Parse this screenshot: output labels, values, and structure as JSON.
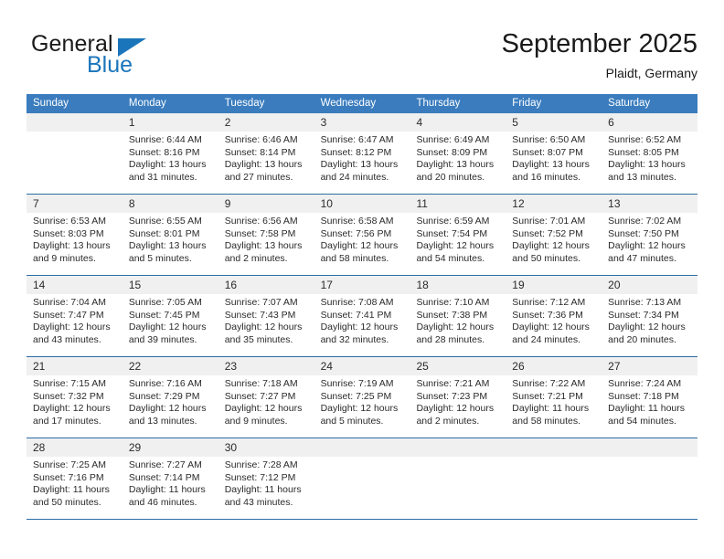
{
  "brand": {
    "name_part1": "General",
    "name_part2": "Blue",
    "accent_color": "#1b75bb"
  },
  "header": {
    "title": "September 2025",
    "subtitle": "Plaidt, Germany"
  },
  "calendar": {
    "header_color": "#3a7cbe",
    "separator_color": "#2b6ca8",
    "daynum_band_color": "#f0f0f0",
    "weekdays": [
      "Sunday",
      "Monday",
      "Tuesday",
      "Wednesday",
      "Thursday",
      "Friday",
      "Saturday"
    ],
    "weeks": [
      [
        {
          "day": "",
          "sunrise": "",
          "sunset": "",
          "daylight_line1": "",
          "daylight_line2": ""
        },
        {
          "day": "1",
          "sunrise": "Sunrise: 6:44 AM",
          "sunset": "Sunset: 8:16 PM",
          "daylight_line1": "Daylight: 13 hours",
          "daylight_line2": "and 31 minutes."
        },
        {
          "day": "2",
          "sunrise": "Sunrise: 6:46 AM",
          "sunset": "Sunset: 8:14 PM",
          "daylight_line1": "Daylight: 13 hours",
          "daylight_line2": "and 27 minutes."
        },
        {
          "day": "3",
          "sunrise": "Sunrise: 6:47 AM",
          "sunset": "Sunset: 8:12 PM",
          "daylight_line1": "Daylight: 13 hours",
          "daylight_line2": "and 24 minutes."
        },
        {
          "day": "4",
          "sunrise": "Sunrise: 6:49 AM",
          "sunset": "Sunset: 8:09 PM",
          "daylight_line1": "Daylight: 13 hours",
          "daylight_line2": "and 20 minutes."
        },
        {
          "day": "5",
          "sunrise": "Sunrise: 6:50 AM",
          "sunset": "Sunset: 8:07 PM",
          "daylight_line1": "Daylight: 13 hours",
          "daylight_line2": "and 16 minutes."
        },
        {
          "day": "6",
          "sunrise": "Sunrise: 6:52 AM",
          "sunset": "Sunset: 8:05 PM",
          "daylight_line1": "Daylight: 13 hours",
          "daylight_line2": "and 13 minutes."
        }
      ],
      [
        {
          "day": "7",
          "sunrise": "Sunrise: 6:53 AM",
          "sunset": "Sunset: 8:03 PM",
          "daylight_line1": "Daylight: 13 hours",
          "daylight_line2": "and 9 minutes."
        },
        {
          "day": "8",
          "sunrise": "Sunrise: 6:55 AM",
          "sunset": "Sunset: 8:01 PM",
          "daylight_line1": "Daylight: 13 hours",
          "daylight_line2": "and 5 minutes."
        },
        {
          "day": "9",
          "sunrise": "Sunrise: 6:56 AM",
          "sunset": "Sunset: 7:58 PM",
          "daylight_line1": "Daylight: 13 hours",
          "daylight_line2": "and 2 minutes."
        },
        {
          "day": "10",
          "sunrise": "Sunrise: 6:58 AM",
          "sunset": "Sunset: 7:56 PM",
          "daylight_line1": "Daylight: 12 hours",
          "daylight_line2": "and 58 minutes."
        },
        {
          "day": "11",
          "sunrise": "Sunrise: 6:59 AM",
          "sunset": "Sunset: 7:54 PM",
          "daylight_line1": "Daylight: 12 hours",
          "daylight_line2": "and 54 minutes."
        },
        {
          "day": "12",
          "sunrise": "Sunrise: 7:01 AM",
          "sunset": "Sunset: 7:52 PM",
          "daylight_line1": "Daylight: 12 hours",
          "daylight_line2": "and 50 minutes."
        },
        {
          "day": "13",
          "sunrise": "Sunrise: 7:02 AM",
          "sunset": "Sunset: 7:50 PM",
          "daylight_line1": "Daylight: 12 hours",
          "daylight_line2": "and 47 minutes."
        }
      ],
      [
        {
          "day": "14",
          "sunrise": "Sunrise: 7:04 AM",
          "sunset": "Sunset: 7:47 PM",
          "daylight_line1": "Daylight: 12 hours",
          "daylight_line2": "and 43 minutes."
        },
        {
          "day": "15",
          "sunrise": "Sunrise: 7:05 AM",
          "sunset": "Sunset: 7:45 PM",
          "daylight_line1": "Daylight: 12 hours",
          "daylight_line2": "and 39 minutes."
        },
        {
          "day": "16",
          "sunrise": "Sunrise: 7:07 AM",
          "sunset": "Sunset: 7:43 PM",
          "daylight_line1": "Daylight: 12 hours",
          "daylight_line2": "and 35 minutes."
        },
        {
          "day": "17",
          "sunrise": "Sunrise: 7:08 AM",
          "sunset": "Sunset: 7:41 PM",
          "daylight_line1": "Daylight: 12 hours",
          "daylight_line2": "and 32 minutes."
        },
        {
          "day": "18",
          "sunrise": "Sunrise: 7:10 AM",
          "sunset": "Sunset: 7:38 PM",
          "daylight_line1": "Daylight: 12 hours",
          "daylight_line2": "and 28 minutes."
        },
        {
          "day": "19",
          "sunrise": "Sunrise: 7:12 AM",
          "sunset": "Sunset: 7:36 PM",
          "daylight_line1": "Daylight: 12 hours",
          "daylight_line2": "and 24 minutes."
        },
        {
          "day": "20",
          "sunrise": "Sunrise: 7:13 AM",
          "sunset": "Sunset: 7:34 PM",
          "daylight_line1": "Daylight: 12 hours",
          "daylight_line2": "and 20 minutes."
        }
      ],
      [
        {
          "day": "21",
          "sunrise": "Sunrise: 7:15 AM",
          "sunset": "Sunset: 7:32 PM",
          "daylight_line1": "Daylight: 12 hours",
          "daylight_line2": "and 17 minutes."
        },
        {
          "day": "22",
          "sunrise": "Sunrise: 7:16 AM",
          "sunset": "Sunset: 7:29 PM",
          "daylight_line1": "Daylight: 12 hours",
          "daylight_line2": "and 13 minutes."
        },
        {
          "day": "23",
          "sunrise": "Sunrise: 7:18 AM",
          "sunset": "Sunset: 7:27 PM",
          "daylight_line1": "Daylight: 12 hours",
          "daylight_line2": "and 9 minutes."
        },
        {
          "day": "24",
          "sunrise": "Sunrise: 7:19 AM",
          "sunset": "Sunset: 7:25 PM",
          "daylight_line1": "Daylight: 12 hours",
          "daylight_line2": "and 5 minutes."
        },
        {
          "day": "25",
          "sunrise": "Sunrise: 7:21 AM",
          "sunset": "Sunset: 7:23 PM",
          "daylight_line1": "Daylight: 12 hours",
          "daylight_line2": "and 2 minutes."
        },
        {
          "day": "26",
          "sunrise": "Sunrise: 7:22 AM",
          "sunset": "Sunset: 7:21 PM",
          "daylight_line1": "Daylight: 11 hours",
          "daylight_line2": "and 58 minutes."
        },
        {
          "day": "27",
          "sunrise": "Sunrise: 7:24 AM",
          "sunset": "Sunset: 7:18 PM",
          "daylight_line1": "Daylight: 11 hours",
          "daylight_line2": "and 54 minutes."
        }
      ],
      [
        {
          "day": "28",
          "sunrise": "Sunrise: 7:25 AM",
          "sunset": "Sunset: 7:16 PM",
          "daylight_line1": "Daylight: 11 hours",
          "daylight_line2": "and 50 minutes."
        },
        {
          "day": "29",
          "sunrise": "Sunrise: 7:27 AM",
          "sunset": "Sunset: 7:14 PM",
          "daylight_line1": "Daylight: 11 hours",
          "daylight_line2": "and 46 minutes."
        },
        {
          "day": "30",
          "sunrise": "Sunrise: 7:28 AM",
          "sunset": "Sunset: 7:12 PM",
          "daylight_line1": "Daylight: 11 hours",
          "daylight_line2": "and 43 minutes."
        },
        {
          "day": "",
          "sunrise": "",
          "sunset": "",
          "daylight_line1": "",
          "daylight_line2": ""
        },
        {
          "day": "",
          "sunrise": "",
          "sunset": "",
          "daylight_line1": "",
          "daylight_line2": ""
        },
        {
          "day": "",
          "sunrise": "",
          "sunset": "",
          "daylight_line1": "",
          "daylight_line2": ""
        },
        {
          "day": "",
          "sunrise": "",
          "sunset": "",
          "daylight_line1": "",
          "daylight_line2": ""
        }
      ]
    ]
  }
}
